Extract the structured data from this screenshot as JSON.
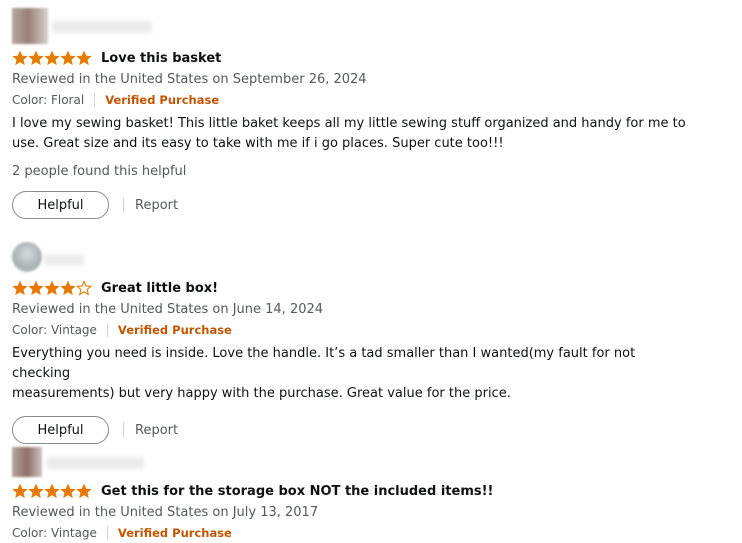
{
  "colors": {
    "star": "#e67a00",
    "verified": "#c45500",
    "text": "#0f1111",
    "muted": "#565959"
  },
  "reviews": [
    {
      "rating": 5,
      "title": "Love this basket",
      "reviewed": "Reviewed in the United States on September 26, 2024",
      "color_label": "Color: Floral",
      "verified": "Verified Purchase",
      "body_lines": [
        "I love my sewing basket! This little baket keeps all my little sewing stuff organized and handy for me to",
        "use. Great size and its easy to take with me if i go places. Super cute too!!!"
      ],
      "helpful_count": "2 people found this helpful",
      "helpful_label": "Helpful",
      "report_label": "Report"
    },
    {
      "rating": 4,
      "title": "Great little box!",
      "reviewed": "Reviewed in the United States on June 14, 2024",
      "color_label": "Color: Vintage",
      "verified": "Verified Purchase",
      "body_lines": [
        "Everything you need is inside. Love the handle. It’s a tad smaller than I wanted(my fault for not checking",
        "measurements) but very happy with the purchase. Great value for the price."
      ],
      "helpful_label": "Helpful",
      "report_label": "Report"
    },
    {
      "rating": 5,
      "title": "Get this for the storage box NOT the included items!!",
      "reviewed": "Reviewed in the United States on July 13, 2017",
      "color_label": "Color: Vintage",
      "verified": "Verified Purchase"
    }
  ]
}
